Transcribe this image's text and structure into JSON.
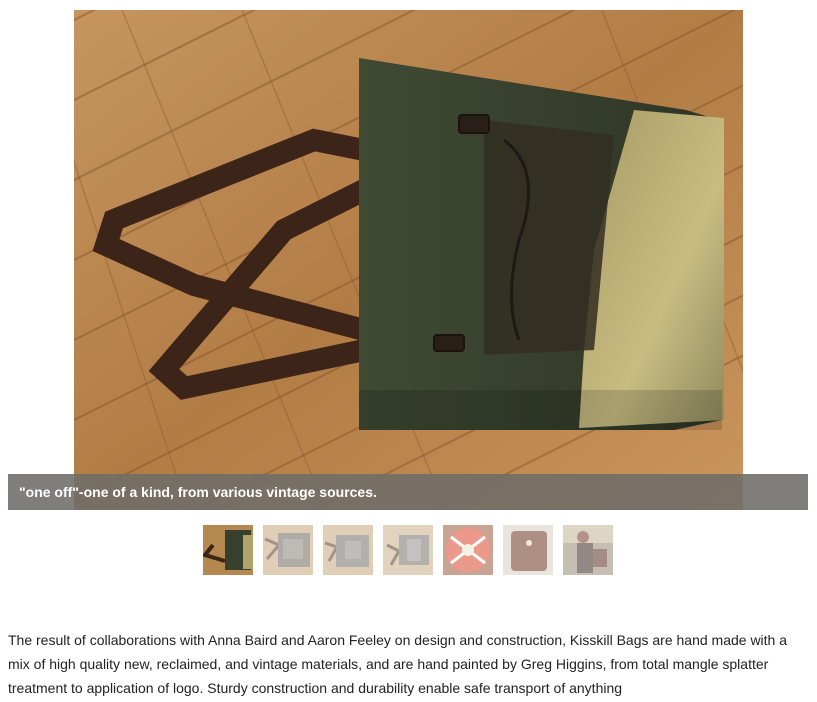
{
  "slideshow": {
    "current_caption": "\"one off\"-one of a kind, from various vintage sources.",
    "main_image_icon": "canvas-messenger-bag-photo",
    "thumbnails": [
      {
        "icon": "green-bag-thumbnail",
        "active": true
      },
      {
        "icon": "grey-bag-thumbnail",
        "active": false
      },
      {
        "icon": "grey-bag-thumbnail",
        "active": false
      },
      {
        "icon": "grey-bag-thumbnail",
        "active": false
      },
      {
        "icon": "orange-bag-thumbnail",
        "active": false
      },
      {
        "icon": "brown-bag-thumbnail",
        "active": false
      },
      {
        "icon": "person-with-bag-thumbnail",
        "active": false
      }
    ]
  },
  "description": {
    "text": "The result of collaborations with Anna Baird and Aaron Feeley on design and construction, Kisskill Bags are hand made with a mix of high quality new, reclaimed, and vintage materials, and are hand painted by Greg Higgins, from total mangle splatter treatment to application of logo. Sturdy construction and durability enable safe transport of anything"
  },
  "colors": {
    "caption_background": "#6e6c69",
    "caption_text": "#ffffff",
    "body_text": "#222222"
  }
}
